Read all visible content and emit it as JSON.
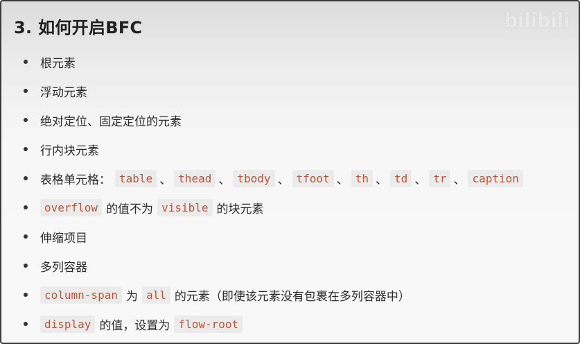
{
  "heading": "3. 如何开启BFC",
  "watermark": "bilibili",
  "items": [
    {
      "text": "根元素"
    },
    {
      "text": "浮动元素"
    },
    {
      "text": "绝对定位、固定定位的元素"
    },
    {
      "text": "行内块元素"
    },
    {
      "label": "表格单元格：",
      "codes": [
        "table",
        "thead",
        "tbody",
        "tfoot",
        "th",
        "td",
        "tr",
        "caption"
      ],
      "separator": "、"
    },
    {
      "code1": "overflow",
      "mid": "的值不为",
      "code2": "visible",
      "tail": "的块元素"
    },
    {
      "text": "伸缩项目"
    },
    {
      "text": "多列容器"
    },
    {
      "code1": "column-span",
      "mid": "为",
      "code2": "all",
      "tail": "的元素（即使该元素没有包裹在多列容器中）"
    },
    {
      "code1": "display",
      "mid": "的值，设置为",
      "code2": "flow-root"
    }
  ]
}
